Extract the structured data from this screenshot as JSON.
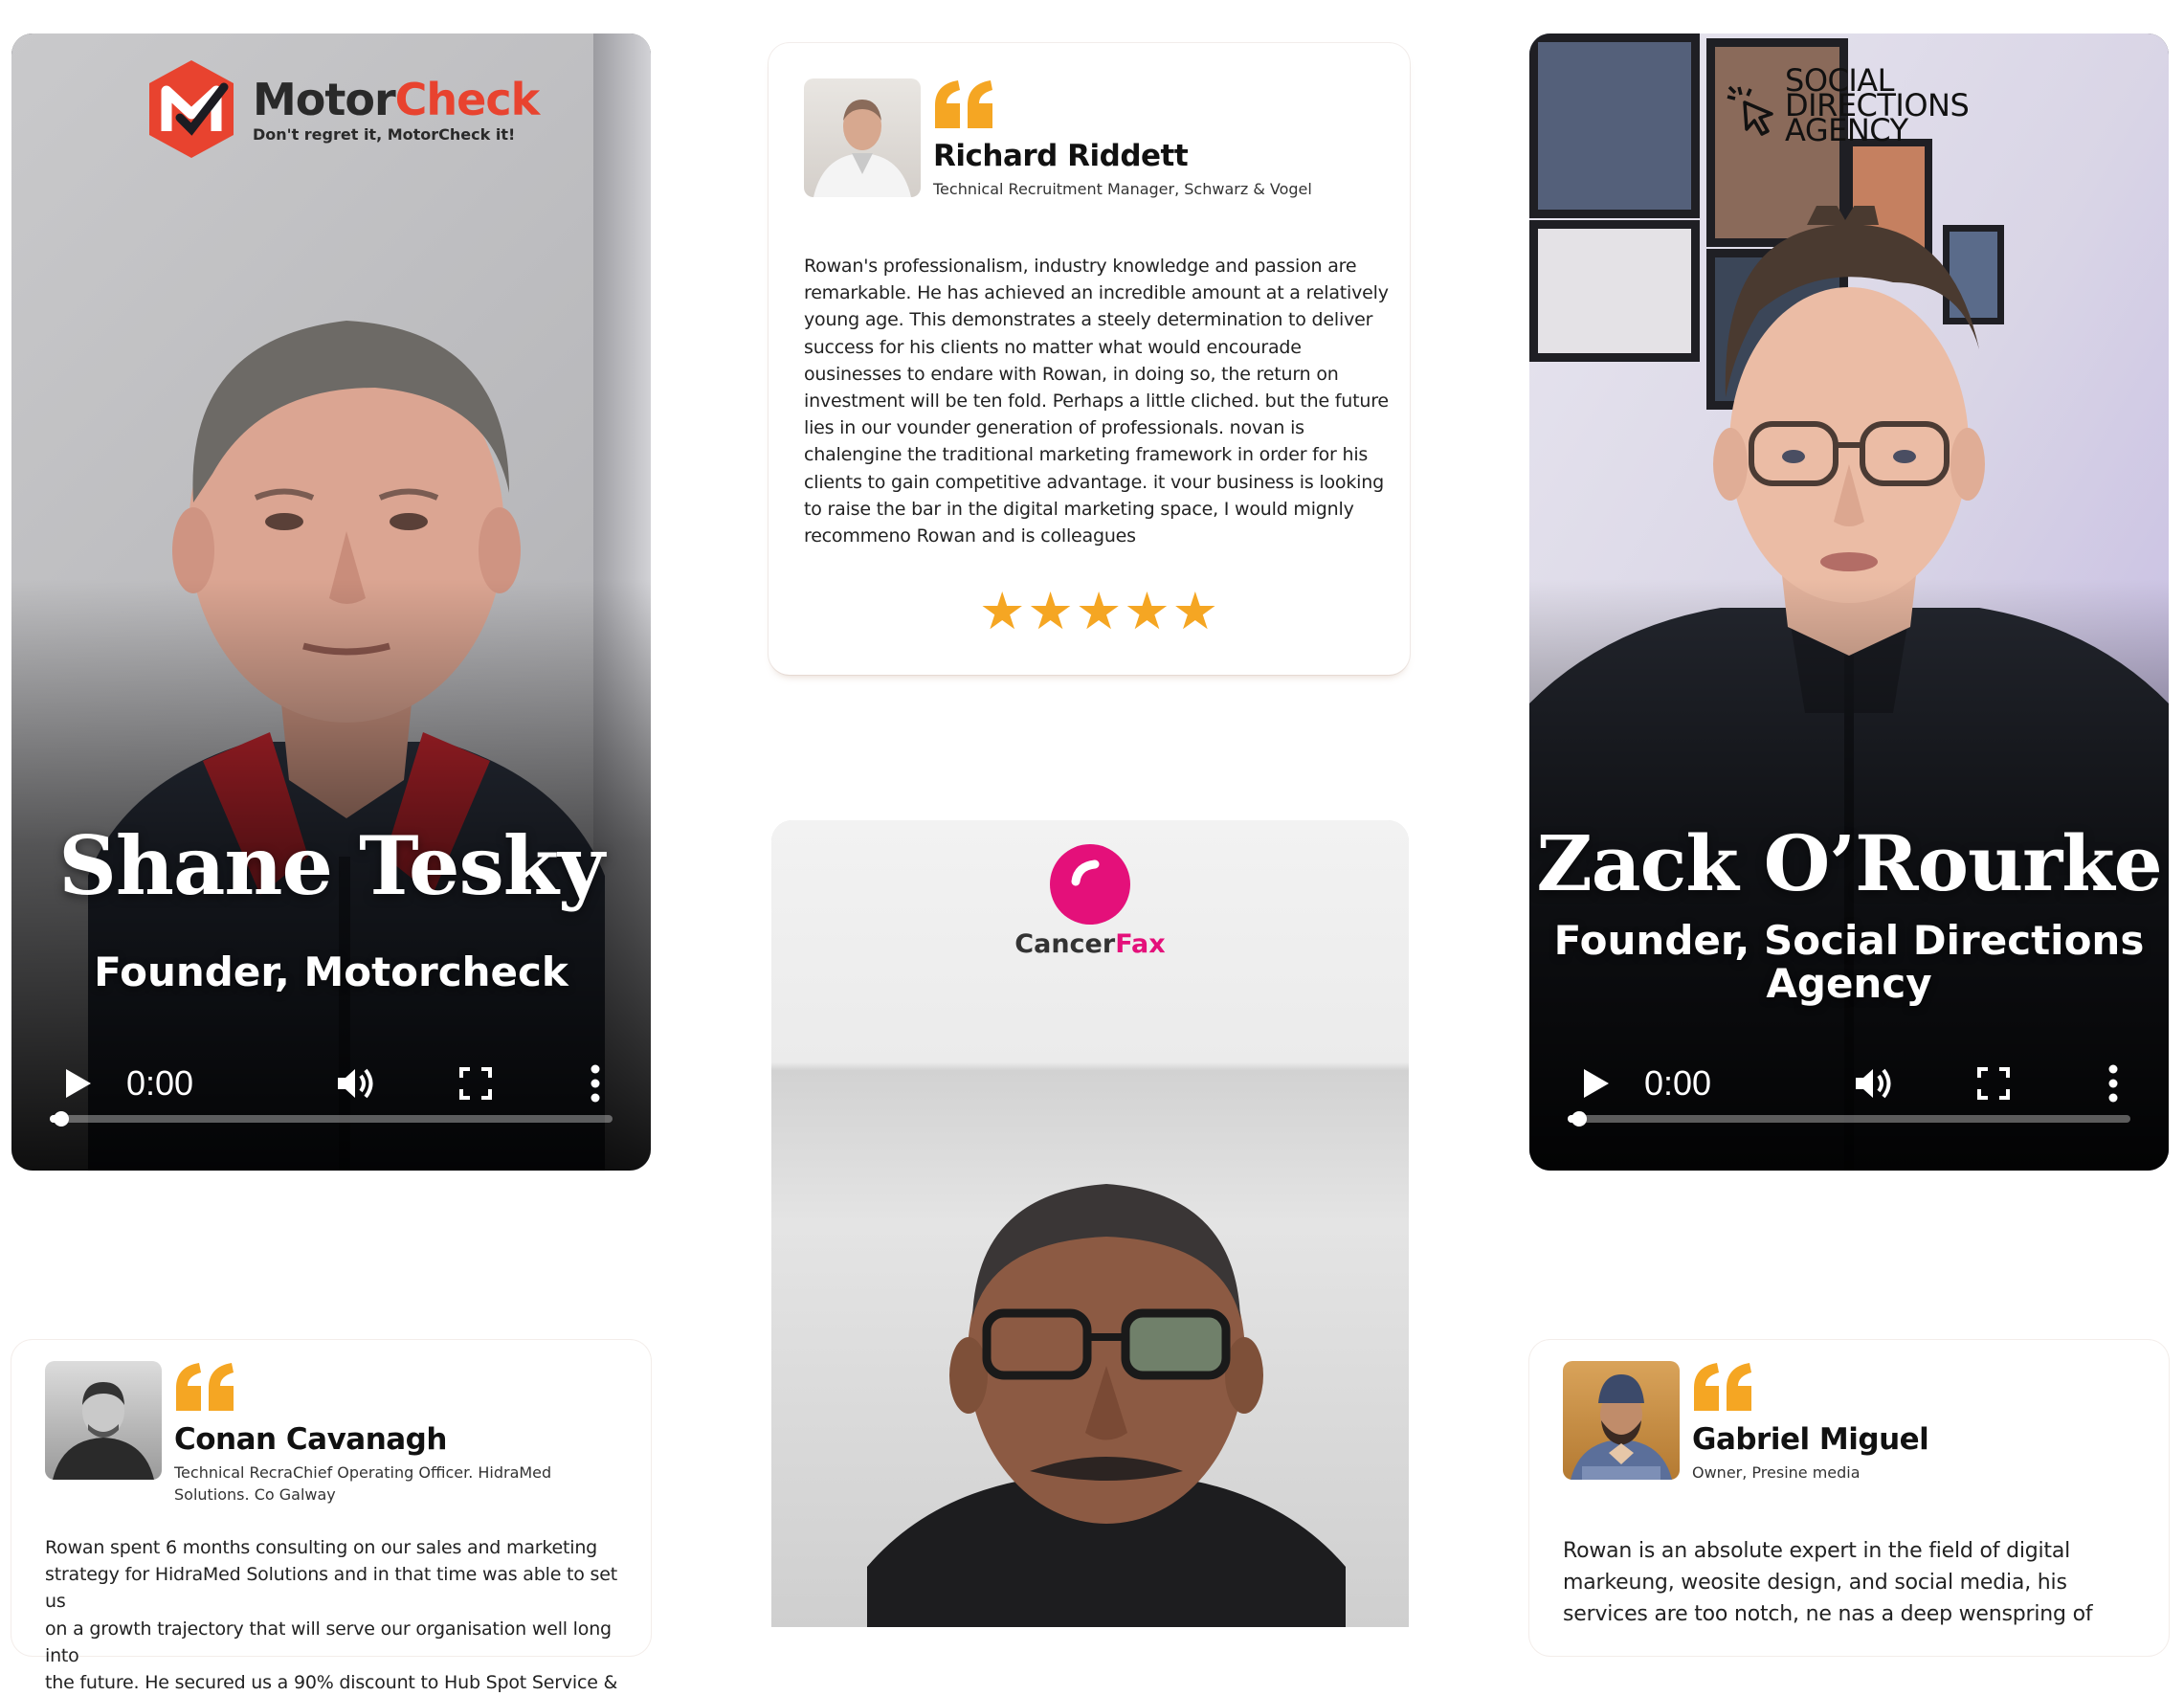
{
  "brand_colors": {
    "accent_orange": "#f5a623",
    "motorcheck_red": "#e8432f",
    "cancerfax_pink": "#e4107a"
  },
  "videos": [
    {
      "logo": {
        "name_part1": "Motor",
        "name_part2": "Check",
        "tagline": "Don't regret it, MotorCheck it!"
      },
      "person_name": "Shane Tesky",
      "role": "Founder, Motorcheck",
      "controls": {
        "time": "0:00",
        "play": "play-icon",
        "volume": "volume-icon",
        "fullscreen": "fullscreen-icon",
        "more": "more-vertical-icon"
      },
      "progress": 0.02
    },
    {
      "logo": {
        "line1": "SOCIAL",
        "line2": "DIRECTIONS",
        "line3": "AGENCY"
      },
      "person_name": "Zack O’Rourke",
      "role_line1": "Founder, Social Directions",
      "role_line2": "Agency",
      "controls": {
        "time": "0:00",
        "play": "play-icon",
        "volume": "volume-icon",
        "fullscreen": "fullscreen-icon",
        "more": "more-vertical-icon"
      },
      "progress": 0.02
    },
    {
      "logo": {
        "name_part1": "Cancer",
        "name_part2": "Fax"
      }
    }
  ],
  "testimonials": [
    {
      "name": "Richard Riddett",
      "role": "Technical Recruitment Manager, Schwarz & Vogel",
      "body_lines": [
        "Rowan's professionalism, industry knowledge and passion are",
        "remarkable. He has achieved an incredible amount at a relatively",
        "young age. This demonstrates a steely determination to deliver",
        "success for his clients no matter what would encourade",
        "ousinesses to endare with Rowan, in doing so, the return on",
        "investment will be ten fold. Perhaps a little cliched. but the future",
        "lies in our vounder generation of professionals. novan is",
        "chalengine the traditional marketing framework in order for his",
        "clients to gain competitive advantage. it vour business is looking",
        "to raise the bar in the digital marketing space, I would mignly",
        "recommeno Rowan and is colleagues"
      ],
      "stars": "★★★★★",
      "rating": 5
    },
    {
      "name": "Conan Cavanagh",
      "role_line1": "Technical RecraChief Operating Officer. HidraMed",
      "role_line2": "Solutions. Co Galway",
      "body_lines": [
        "Rowan spent 6 months consulting on our sales and marketing",
        "strategy for HidraMed Solutions and in that time was able to set us",
        "on a growth trajectory that will serve our organisation well long into",
        "the future. He secured us a 90% discount to Hub Spot Service &"
      ]
    },
    {
      "name": "Gabriel Miguel",
      "role": "Owner, Presine media",
      "body_lines": [
        "Rowan is an absolute expert in the field of digital",
        "markeung, weosite design, and social media, his",
        "services are too notch, ne nas a deep wenspring of"
      ]
    }
  ]
}
